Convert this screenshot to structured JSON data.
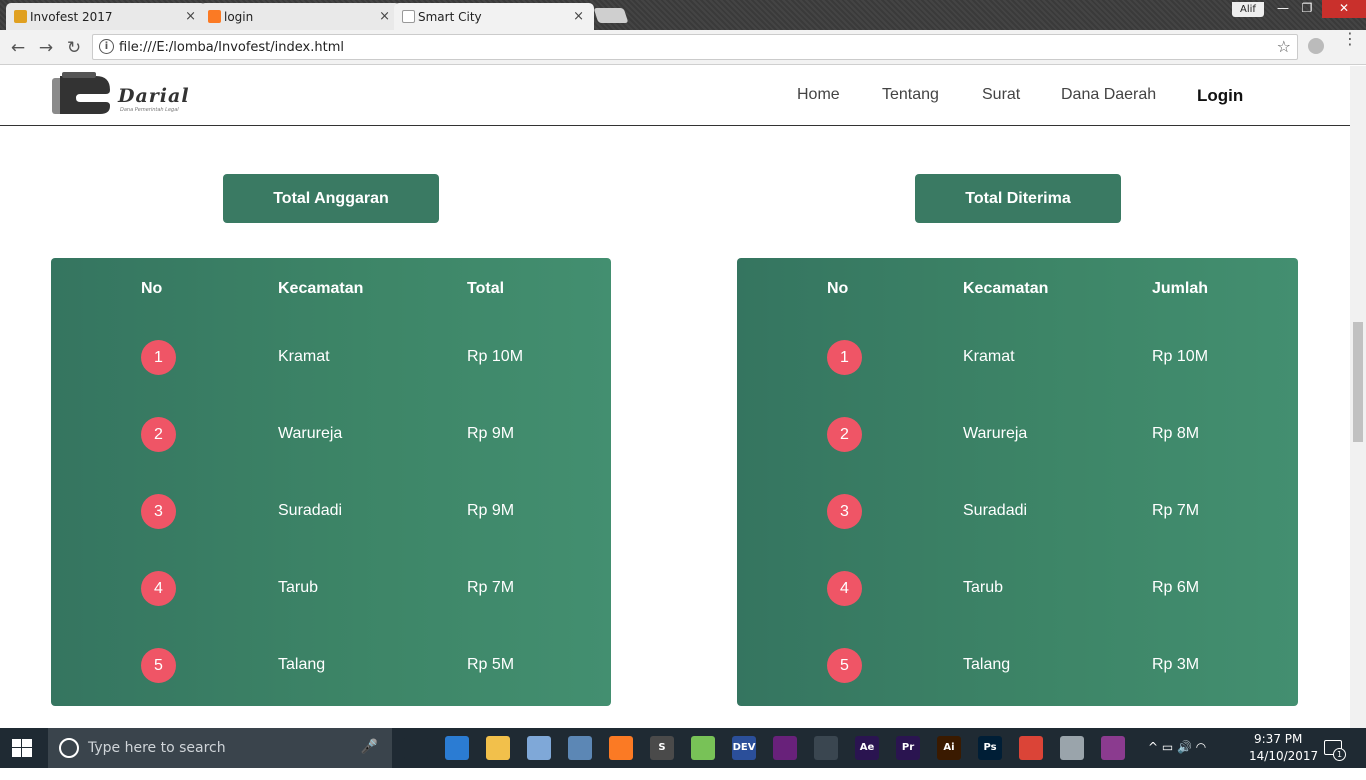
{
  "browser": {
    "tabs": [
      {
        "label": "Invofest 2017",
        "icon": "v-logo-icon",
        "icon_color": "#e0a020"
      },
      {
        "label": "login",
        "icon": "xampp-icon",
        "icon_color": "#fb7a24"
      },
      {
        "label": "Smart City",
        "icon": "page-icon",
        "icon_color": "#cccccc"
      }
    ],
    "tab_close_glyph": "×",
    "user": "Alif",
    "window_controls": {
      "minimize": "—",
      "restore": "❐",
      "close": "✕"
    },
    "nav": {
      "back": "←",
      "forward": "→",
      "reload": "↻"
    },
    "url": "file:///E:/lomba/Invofest/index.html",
    "info_glyph": "i",
    "star_glyph": "☆",
    "menu_glyph": "⋮"
  },
  "site": {
    "logo_text": "Darial",
    "logo_tagline": "Dana Pemerintah Legal",
    "nav": [
      "Home",
      "Tentang",
      "Surat",
      "Dana Daerah",
      "Login"
    ]
  },
  "left": {
    "button": "Total Anggaran",
    "headers": [
      "No",
      "Kecamatan",
      "Total"
    ],
    "rows": [
      {
        "no": "1",
        "kecamatan": "Kramat",
        "value": "Rp 10M"
      },
      {
        "no": "2",
        "kecamatan": "Warureja",
        "value": "Rp 9M"
      },
      {
        "no": "3",
        "kecamatan": "Suradadi",
        "value": "Rp 9M"
      },
      {
        "no": "4",
        "kecamatan": "Tarub",
        "value": "Rp 7M"
      },
      {
        "no": "5",
        "kecamatan": "Talang",
        "value": "Rp 5M"
      }
    ]
  },
  "right": {
    "button": "Total Diterima",
    "headers": [
      "No",
      "Kecamatan",
      "Jumlah"
    ],
    "rows": [
      {
        "no": "1",
        "kecamatan": "Kramat",
        "value": "Rp 10M"
      },
      {
        "no": "2",
        "kecamatan": "Warureja",
        "value": "Rp 8M"
      },
      {
        "no": "3",
        "kecamatan": "Suradadi",
        "value": "Rp 7M"
      },
      {
        "no": "4",
        "kecamatan": "Tarub",
        "value": "Rp 6M"
      },
      {
        "no": "5",
        "kecamatan": "Talang",
        "value": "Rp 3M"
      }
    ]
  },
  "colors": {
    "panel": "#3d8567",
    "button": "#3a7a63",
    "badge": "#ef5566"
  },
  "taskbar": {
    "search_placeholder": "Type here to search",
    "mic_glyph": "🎤",
    "apps": [
      {
        "name": "task-view",
        "label": "",
        "color": "#1f2a33"
      },
      {
        "name": "store",
        "label": "",
        "color": "#2b7cd3"
      },
      {
        "name": "file-explorer",
        "label": "",
        "color": "#f2c04b"
      },
      {
        "name": "3d-box",
        "label": "",
        "color": "#7fa8d8"
      },
      {
        "name": "virtualbox",
        "label": "",
        "color": "#5c87b5"
      },
      {
        "name": "xampp",
        "label": "",
        "color": "#fb7a24"
      },
      {
        "name": "sublime",
        "label": "S",
        "color": "#4a4a4a"
      },
      {
        "name": "android-studio",
        "label": "",
        "color": "#78c257"
      },
      {
        "name": "dev-cpp",
        "label": "DEV",
        "color": "#2b4f9a"
      },
      {
        "name": "visual-studio",
        "label": "",
        "color": "#68217a"
      },
      {
        "name": "media",
        "label": "",
        "color": "#3a4650"
      },
      {
        "name": "after-effects",
        "label": "Ae",
        "color": "#2a1450"
      },
      {
        "name": "premiere",
        "label": "Pr",
        "color": "#2a1450"
      },
      {
        "name": "illustrator",
        "label": "Ai",
        "color": "#3a1a00"
      },
      {
        "name": "photoshop",
        "label": "Ps",
        "color": "#001e36"
      },
      {
        "name": "chrome",
        "label": "",
        "color": "#db4437"
      },
      {
        "name": "drop",
        "label": "",
        "color": "#9aa4ab"
      },
      {
        "name": "winrar",
        "label": "",
        "color": "#8b3b8f"
      }
    ],
    "tray_glyphs": "^  ▭  🔊  ◠",
    "time": "9:37 PM",
    "date": "14/10/2017",
    "notification_count": "1"
  }
}
